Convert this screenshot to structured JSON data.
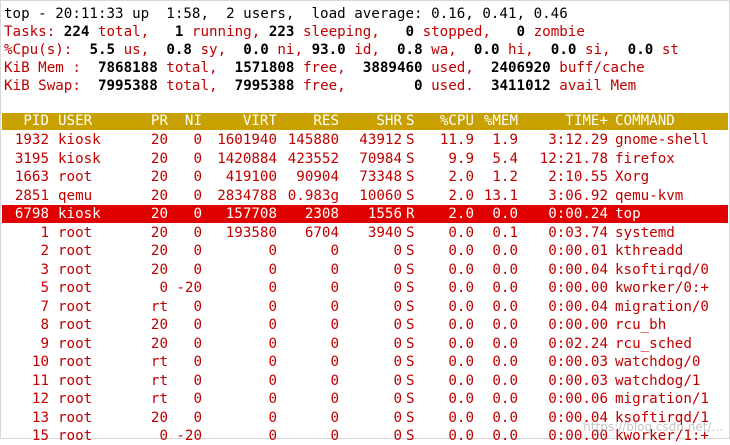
{
  "summary": {
    "line1": "top - 20:11:33 up  1:58,  2 users,  load average: 0.16, 0.41, 0.46",
    "tasks": {
      "label": "Tasks:",
      "total": "224",
      "total_label": " total,",
      "running": "1",
      "running_label": " running,",
      "sleeping": "223",
      "sleeping_label": " sleeping,",
      "stopped": "0",
      "stopped_label": " stopped,",
      "zombie": "0",
      "zombie_label": " zombie"
    },
    "cpu": {
      "label": "%Cpu(s):",
      "us": "5.5",
      "us_label": " us,",
      "sy": "0.8",
      "sy_label": " sy,",
      "ni": "0.0",
      "ni_label": " ni,",
      "id": "93.0",
      "id_label": " id,",
      "wa": "0.8",
      "wa_label": " wa,",
      "hi": "0.0",
      "hi_label": " hi,",
      "si": "0.0",
      "si_label": " si,",
      "st": "0.0",
      "st_label": " st"
    },
    "mem": {
      "label": "KiB Mem :",
      "total": "7868188",
      "total_label": " total,",
      "free": "1571808",
      "free_label": " free,",
      "used": "3889460",
      "used_label": " used,",
      "buff": "2406920",
      "buff_label": " buff/cache"
    },
    "swap": {
      "label": "KiB Swap:",
      "total": "7995388",
      "total_label": " total,",
      "free": "7995388",
      "free_label": " free,",
      "used": "0",
      "used_label": " used.",
      "avail": "3411012",
      "avail_label": " avail Mem"
    }
  },
  "columns": [
    "PID",
    "USER",
    "PR",
    "NI",
    "VIRT",
    "RES",
    "SHR",
    "S",
    "%CPU",
    "%MEM",
    "TIME+",
    "COMMAND"
  ],
  "processes": [
    [
      "1932",
      "kiosk",
      "20",
      "0",
      "1601940",
      "145880",
      "43912",
      "S",
      "11.9",
      "1.9",
      "3:12.29",
      "gnome-shell"
    ],
    [
      "3195",
      "kiosk",
      "20",
      "0",
      "1420884",
      "423552",
      "70984",
      "S",
      "9.9",
      "5.4",
      "12:21.78",
      "firefox"
    ],
    [
      "1663",
      "root",
      "20",
      "0",
      "419100",
      "90904",
      "73348",
      "S",
      "2.0",
      "1.2",
      "2:10.55",
      "Xorg"
    ],
    [
      "2851",
      "qemu",
      "20",
      "0",
      "2834788",
      "0.983g",
      "10060",
      "S",
      "2.0",
      "13.1",
      "3:06.92",
      "qemu-kvm"
    ],
    [
      "6798",
      "kiosk",
      "20",
      "0",
      "157708",
      "2308",
      "1556",
      "R",
      "2.0",
      "0.0",
      "0:00.24",
      "top"
    ],
    [
      "1",
      "root",
      "20",
      "0",
      "193580",
      "6704",
      "3940",
      "S",
      "0.0",
      "0.1",
      "0:03.74",
      "systemd"
    ],
    [
      "2",
      "root",
      "20",
      "0",
      "0",
      "0",
      "0",
      "S",
      "0.0",
      "0.0",
      "0:00.01",
      "kthreadd"
    ],
    [
      "3",
      "root",
      "20",
      "0",
      "0",
      "0",
      "0",
      "S",
      "0.0",
      "0.0",
      "0:00.04",
      "ksoftirqd/0"
    ],
    [
      "5",
      "root",
      "0",
      "-20",
      "0",
      "0",
      "0",
      "S",
      "0.0",
      "0.0",
      "0:00.00",
      "kworker/0:+"
    ],
    [
      "7",
      "root",
      "rt",
      "0",
      "0",
      "0",
      "0",
      "S",
      "0.0",
      "0.0",
      "0:00.04",
      "migration/0"
    ],
    [
      "8",
      "root",
      "20",
      "0",
      "0",
      "0",
      "0",
      "S",
      "0.0",
      "0.0",
      "0:00.00",
      "rcu_bh"
    ],
    [
      "9",
      "root",
      "20",
      "0",
      "0",
      "0",
      "0",
      "S",
      "0.0",
      "0.0",
      "0:02.24",
      "rcu_sched"
    ],
    [
      "10",
      "root",
      "rt",
      "0",
      "0",
      "0",
      "0",
      "S",
      "0.0",
      "0.0",
      "0:00.03",
      "watchdog/0"
    ],
    [
      "11",
      "root",
      "rt",
      "0",
      "0",
      "0",
      "0",
      "S",
      "0.0",
      "0.0",
      "0:00.03",
      "watchdog/1"
    ],
    [
      "12",
      "root",
      "rt",
      "0",
      "0",
      "0",
      "0",
      "S",
      "0.0",
      "0.0",
      "0:00.06",
      "migration/1"
    ],
    [
      "13",
      "root",
      "20",
      "0",
      "0",
      "0",
      "0",
      "S",
      "0.0",
      "0.0",
      "0:00.04",
      "ksoftirqd/1"
    ],
    [
      "15",
      "root",
      "0",
      "-20",
      "0",
      "0",
      "0",
      "S",
      "0.0",
      "0.0",
      "0:00.00",
      "kworker/1:+"
    ]
  ],
  "selected_pid": "6798",
  "watermark": "https://blog.csdn.net/..."
}
